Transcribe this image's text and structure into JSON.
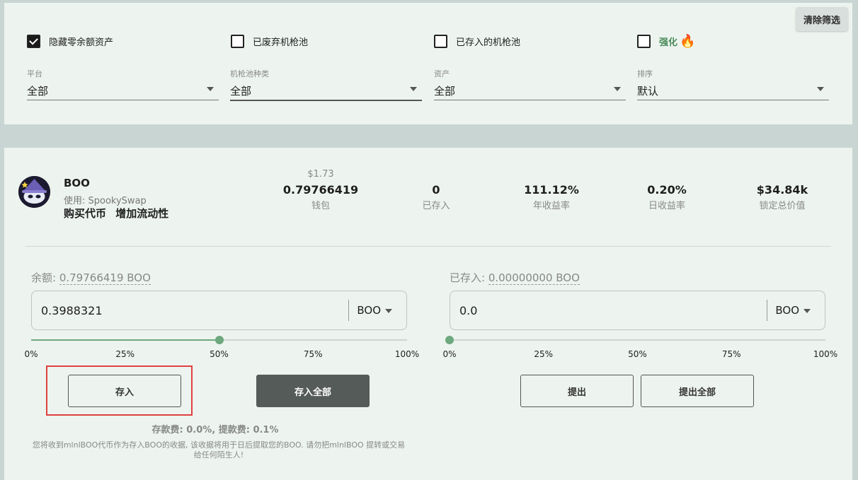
{
  "filters": {
    "clear_label": "清除筛选",
    "checkboxes": [
      {
        "label": "隐藏零余额资产",
        "checked": true
      },
      {
        "label": "已废弃机枪池",
        "checked": false
      },
      {
        "label": "已存入的机枪池",
        "checked": false
      },
      {
        "label": "强化",
        "checked": false
      }
    ],
    "selects": [
      {
        "label": "平台",
        "value": "全部"
      },
      {
        "label": "机枪池种类",
        "value": "全部"
      },
      {
        "label": "资产",
        "value": "全部"
      },
      {
        "label": "排序",
        "value": "默认"
      }
    ]
  },
  "vault": {
    "token": "BOO",
    "platform": "使用: SpookySwap",
    "links": [
      "购买代币",
      "增加流动性"
    ],
    "price": "$1.73",
    "stats": [
      {
        "value": "0.79766419",
        "label": "钱包"
      },
      {
        "value": "0",
        "label": "已存入"
      },
      {
        "value": "111.12%",
        "label": "年收益率"
      },
      {
        "value": "0.20%",
        "label": "日收益率"
      },
      {
        "value": "$34.84k",
        "label": "锁定总价值"
      }
    ]
  },
  "deposit": {
    "balance_label": "余额: ",
    "balance_value": "0.79766419 BOO",
    "input_value": "0.3988321",
    "token": "BOO",
    "slider_percent": 50,
    "ticks": [
      "0%",
      "25%",
      "50%",
      "75%",
      "100%"
    ],
    "deposit_label": "存入",
    "deposit_all_label": "存入全部",
    "fee_text": "存款费: 0.0%, 提款费: 0.1%",
    "note_text": "您将收到mlnlBOO代币作为存入BOO的收据, 该收据将用于日后提取您的BOO. 请勿把mlnlBOO 提转或交易给任何陌生人!"
  },
  "withdraw": {
    "balance_label": "已存入: ",
    "balance_value": "0.00000000 BOO",
    "input_value": "0.0",
    "token": "BOO",
    "slider_percent": 0,
    "ticks": [
      "0%",
      "25%",
      "50%",
      "75%",
      "100%"
    ],
    "withdraw_label": "提出",
    "withdraw_all_label": "提出全部"
  }
}
